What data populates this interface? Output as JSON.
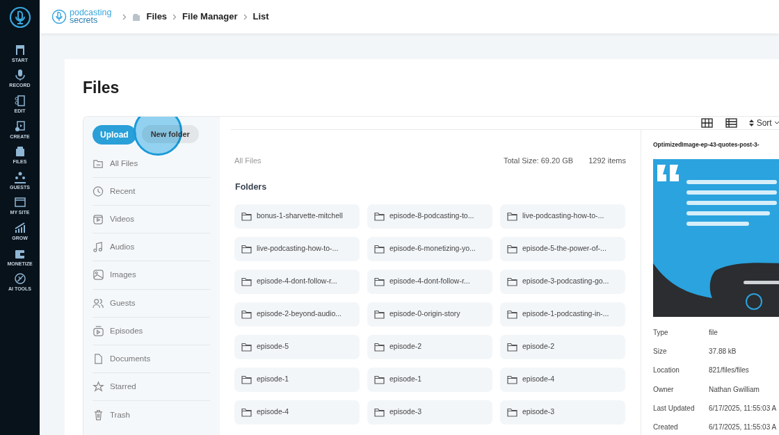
{
  "app_nav": [
    "START",
    "RECORD",
    "EDIT",
    "CREATE",
    "FILES",
    "GUESTS",
    "MY SITE",
    "GROW",
    "MONETIZE",
    "AI TOOLS"
  ],
  "brand": {
    "line1": "podcasting",
    "line2": "secrets"
  },
  "breadcrumb": [
    "Files",
    "File Manager",
    "List"
  ],
  "page_title": "Files",
  "actions": {
    "upload": "Upload",
    "new_folder": "New folder"
  },
  "file_nav": [
    "All Files",
    "Recent",
    "Videos",
    "Audios",
    "Images",
    "Guests",
    "Episodes",
    "Documents",
    "Starred",
    "Trash"
  ],
  "toolbar": {
    "sort": "Sort"
  },
  "location": "All Files",
  "total_size": "Total Size: 69.20 GB",
  "item_count": "1292 items",
  "folders_heading": "Folders",
  "folders": [
    "bonus-1-sharvette-mitchell",
    "episode-8-podcasting-to...",
    "live-podcasting-how-to-...",
    "live-podcasting-how-to-...",
    "episode-6-monetizing-yo...",
    "episode-5-the-power-of-...",
    "episode-4-dont-follow-r...",
    "episode-4-dont-follow-r...",
    "episode-3-podcasting-go...",
    "episode-2-beyond-audio...",
    "episode-0-origin-story",
    "episode-1-podcasting-in-...",
    "episode-5",
    "episode-2",
    "episode-2",
    "episode-1",
    "episode-1",
    "episode-4",
    "episode-4",
    "episode-3",
    "episode-3"
  ],
  "details": {
    "file_name": "OptimizedImage-ep-43-quotes-post-3-",
    "properties": [
      {
        "label": "Type",
        "value": "file"
      },
      {
        "label": "Size",
        "value": "37.88 kB"
      },
      {
        "label": "Location",
        "value": "821/files/files"
      },
      {
        "label": "Owner",
        "value": "Nathan Gwilliam"
      },
      {
        "label": "Last Updated",
        "value": "6/17/2025, 11:55:03 A"
      },
      {
        "label": "Created",
        "value": "6/17/2025, 11:55:03 A"
      }
    ]
  }
}
